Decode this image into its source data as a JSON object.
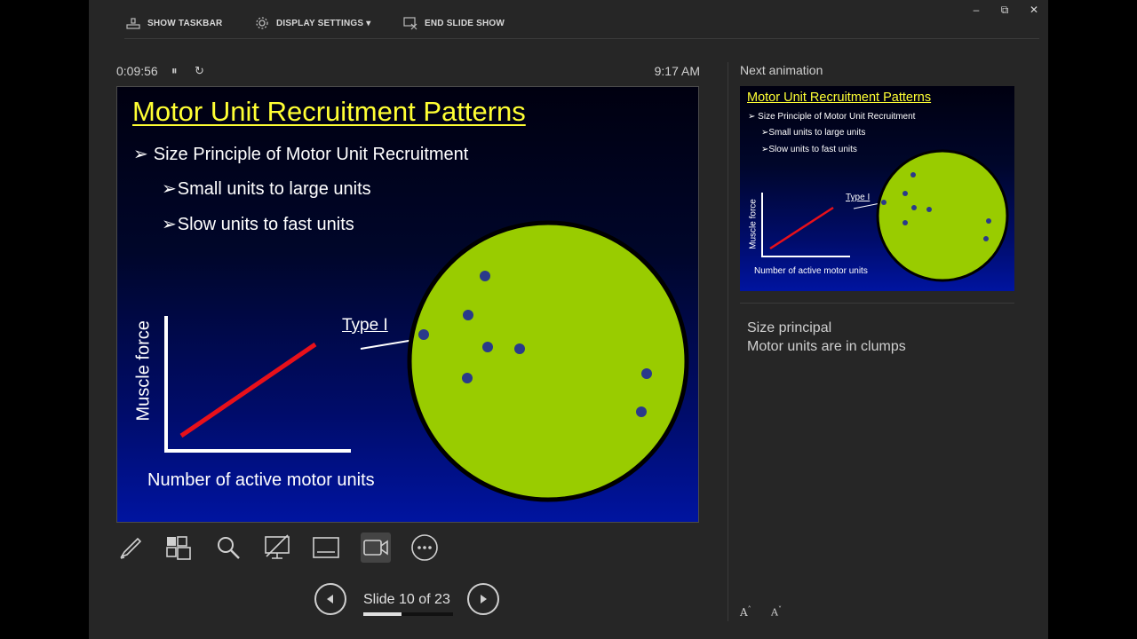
{
  "topbar": {
    "show_taskbar": "SHOW TASKBAR",
    "display_settings": "DISPLAY SETTINGS ▾",
    "end_slide_show": "END SLIDE SHOW"
  },
  "window": {
    "minimize": "–",
    "restore": "⧉",
    "close": "✕"
  },
  "presenter": {
    "elapsed_time": "0:09:56",
    "pause_glyph": "⏸",
    "restart_glyph": "↻",
    "clock": "9:17 AM"
  },
  "slide": {
    "title": "Motor Unit Recruitment Patterns",
    "bullet_1": "Size Principle of Motor Unit Recruitment",
    "bullet_2": "Small units to large units",
    "bullet_3": "Slow units to fast units",
    "bullet_marker": "➢",
    "graph_y_label": "Muscle force",
    "graph_x_label": "Number of active motor units",
    "type_label": "Type I",
    "colors": {
      "background": "#000c6a",
      "title": "#ffff33",
      "muscle": "#99cc00",
      "line": "#e8101a",
      "dot": "#2a3a8a"
    }
  },
  "tools": [
    {
      "name": "pen-icon"
    },
    {
      "name": "see-all-slides-icon"
    },
    {
      "name": "zoom-icon"
    },
    {
      "name": "black-screen-icon"
    },
    {
      "name": "subtitles-icon"
    },
    {
      "name": "camera-icon"
    },
    {
      "name": "more-options-icon"
    }
  ],
  "navigation": {
    "slide_counter": "Slide 10 of 23",
    "current_slide": 10,
    "total_slides": 23,
    "progress": 0.43
  },
  "next_panel": {
    "label": "Next animation",
    "preview_title": "Motor Unit Recruitment Patterns",
    "preview_bullet_1": "Size Principle of Motor Unit Recruitment",
    "preview_bullet_2": "Small units to large units",
    "preview_bullet_3": "Slow units to fast units",
    "preview_y_label": "Muscle force",
    "preview_x_label": "Number of active motor units",
    "preview_type_label": "Type I"
  },
  "notes": {
    "line_1": "Size principal",
    "line_2": "Motor units are in clumps"
  },
  "font_controls": {
    "increase": "A",
    "decrease": "A"
  }
}
